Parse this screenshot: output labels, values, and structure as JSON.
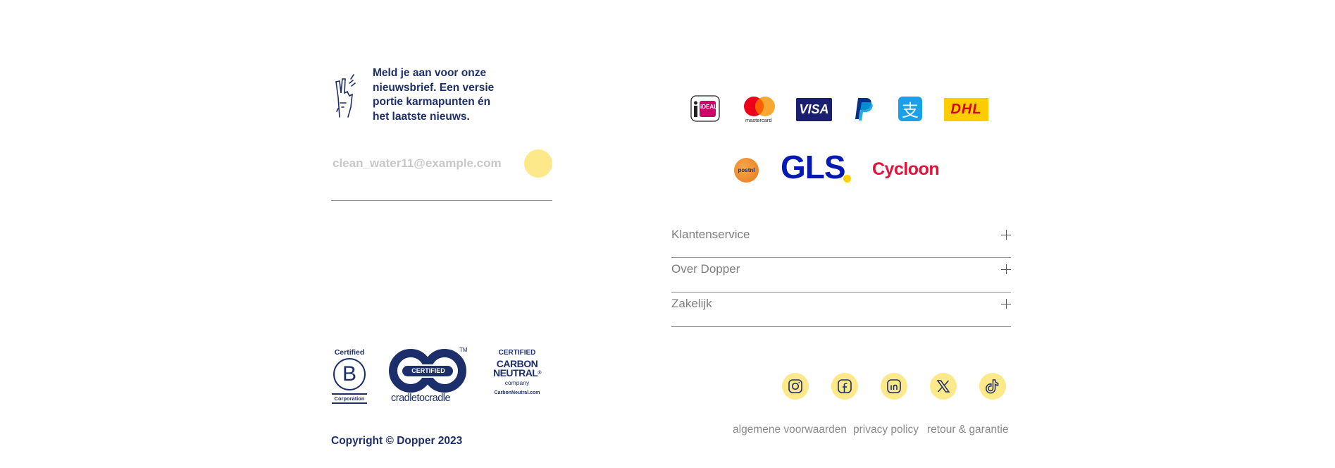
{
  "newsletter": {
    "text": "Meld je aan voor onze nieuwsbrief. Een versie portie karmapunten én het laatste nieuws.",
    "email_value": "clean_water11@example.com"
  },
  "payment_methods": [
    {
      "name": "iDEAL",
      "label": "iDEAL",
      "color": "#cc0066"
    },
    {
      "name": "Mastercard",
      "label": "mastercard",
      "color": "#eb001b"
    },
    {
      "name": "Visa",
      "label": "VISA",
      "color": "#1a1f71"
    },
    {
      "name": "PayPal",
      "label": "",
      "color": "#003087"
    },
    {
      "name": "Alipay",
      "label": "支",
      "color": "#1aa0e8"
    },
    {
      "name": "DHL",
      "label": "DHL",
      "color": "#d40511"
    }
  ],
  "shipping_methods": [
    {
      "name": "PostNL",
      "label": "postnl",
      "color": "#f08c2e"
    },
    {
      "name": "GLS",
      "label": "GLS",
      "color": "#061ab1"
    },
    {
      "name": "Cycloon",
      "label": "Cycloon",
      "color": "#e3123a"
    }
  ],
  "accordion": [
    {
      "label": "Klantenservice"
    },
    {
      "label": "Over Dopper"
    },
    {
      "label": "Zakelijk"
    }
  ],
  "certifications": {
    "bcorp_top": "Certified",
    "bcorp_letter": "B",
    "bcorp_bottom": "Corporation",
    "c2c_badge": "CERTIFIED",
    "c2c_name": "cradletocradle",
    "c2c_tm": "TM",
    "carbon_top": "CERTIFIED",
    "carbon_mid1": "CARBON",
    "carbon_mid2": "NEUTRAL",
    "carbon_reg": "®",
    "carbon_company": "company",
    "carbon_url": "CarbonNeutral.com"
  },
  "social": [
    "instagram-icon",
    "facebook-icon",
    "linkedin-icon",
    "x-icon",
    "tiktok-icon"
  ],
  "legal_links": [
    "algemene voorwaarden",
    "privacy policy",
    "retour & garantie"
  ],
  "copyright": "Copyright © Dopper 2023",
  "colors": {
    "navy": "#1d2f6b",
    "accent_yellow": "#fde98a"
  }
}
